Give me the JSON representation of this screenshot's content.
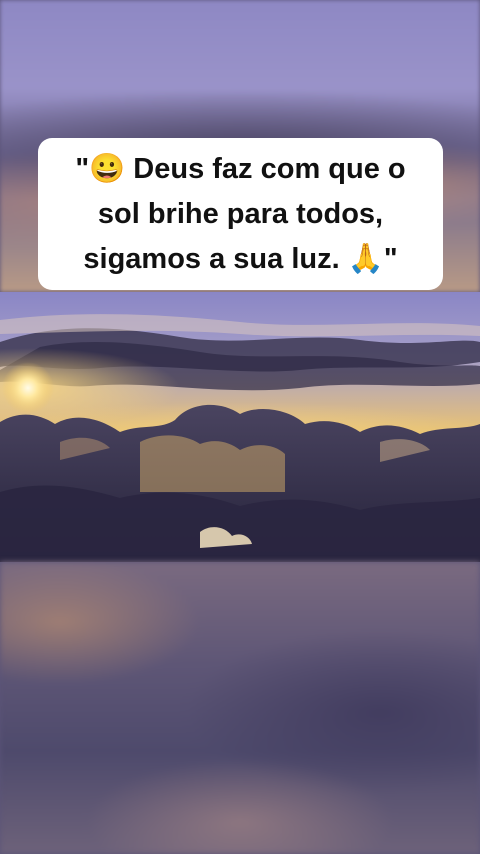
{
  "caption": {
    "lines": [
      "\"😀 Deus faz com que o",
      "sol brihe para todos,",
      "sigamos a sua luz. 🙏\""
    ]
  },
  "photo": {
    "subject": "sunset-above-clouds"
  },
  "colors": {
    "caption_background": "#ffffff",
    "caption_text": "#111111",
    "sky_top": "#8e88c4",
    "sun_glow": "#f2c25a",
    "cloud_dark": "#2e2a44"
  }
}
